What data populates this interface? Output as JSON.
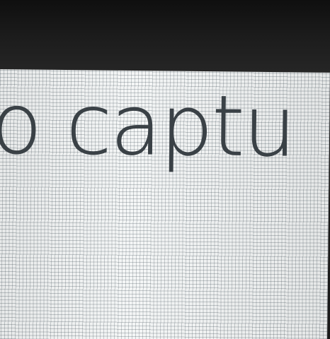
{
  "screen": {
    "visible_text": "to captu",
    "text_color": "#3a4146",
    "background_color": "#f4f6f6"
  },
  "bezel": {
    "color": "#1a1a1a"
  }
}
